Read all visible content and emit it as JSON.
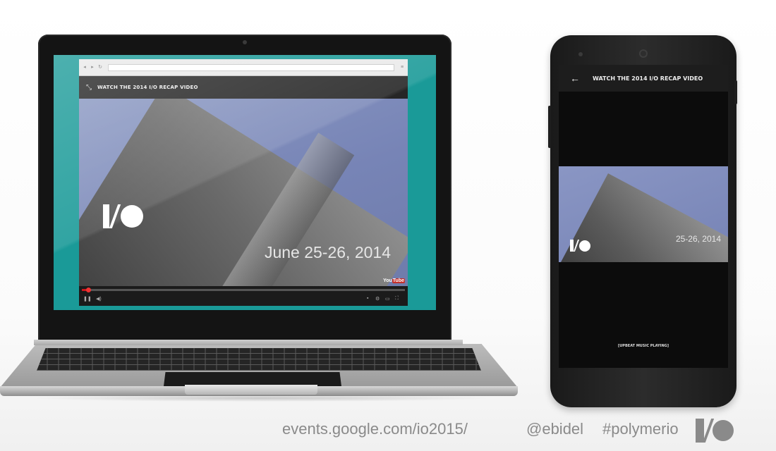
{
  "laptop": {
    "browser": {
      "app_title": "WATCH THE 2014 I/O RECAP VIDEO",
      "app_icon": "expand-icon"
    },
    "video": {
      "logo": "I/O",
      "date_overlay": "June 25-26, 2014",
      "watermark": "YouTube",
      "progress": 0.02
    }
  },
  "phone": {
    "app_title": "WATCH THE 2014 I/O RECAP VIDEO",
    "back_icon": "arrow-back-icon",
    "video": {
      "logo": "I/O",
      "date_overlay": "25-26, 2014"
    },
    "caption": "[UPBEAT MUSIC PLAYING]"
  },
  "footer": {
    "url": "events.google.com/io2015/",
    "handle": "@ebidel",
    "hashtag": "#polymerio",
    "logo": "I/O"
  },
  "colors": {
    "teal_background": "#1a9a98",
    "video_sky": "#7784b6",
    "footer_text": "#8a8a8a",
    "progress_red": "#cc181e"
  }
}
